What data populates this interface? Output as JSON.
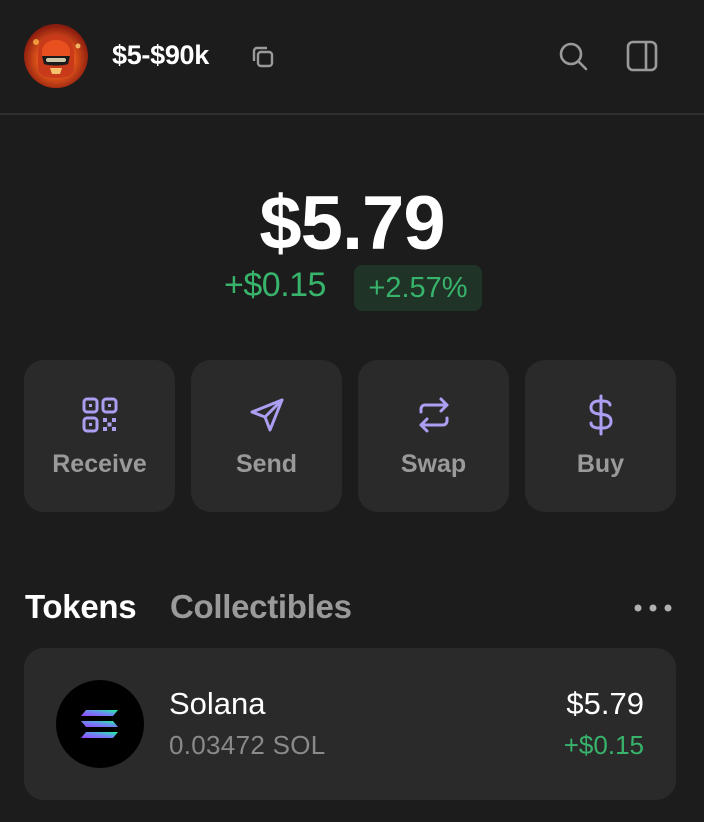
{
  "header": {
    "account_name": "$5-$90k",
    "icons": [
      "avatar",
      "copy-icon",
      "search-icon",
      "sidebar-icon"
    ]
  },
  "balance": {
    "total": "$5.79",
    "change_abs": "+$0.15",
    "change_pct": "+2.57%"
  },
  "actions": [
    {
      "label": "Receive",
      "icon": "qr-code-icon"
    },
    {
      "label": "Send",
      "icon": "send-icon"
    },
    {
      "label": "Swap",
      "icon": "swap-icon"
    },
    {
      "label": "Buy",
      "icon": "dollar-icon"
    }
  ],
  "tabs": [
    {
      "label": "Tokens",
      "active": true
    },
    {
      "label": "Collectibles",
      "active": false
    }
  ],
  "tokens": [
    {
      "name": "Solana",
      "amount": "0.03472 SOL",
      "value": "$5.79",
      "change": "+$0.15",
      "icon": "solana-logo-icon"
    }
  ],
  "colors": {
    "background": "#1c1c1c",
    "card": "#2a2a2a",
    "accent": "#ab9ff2",
    "positive": "#37b36b",
    "muted": "#9a9a9a"
  }
}
